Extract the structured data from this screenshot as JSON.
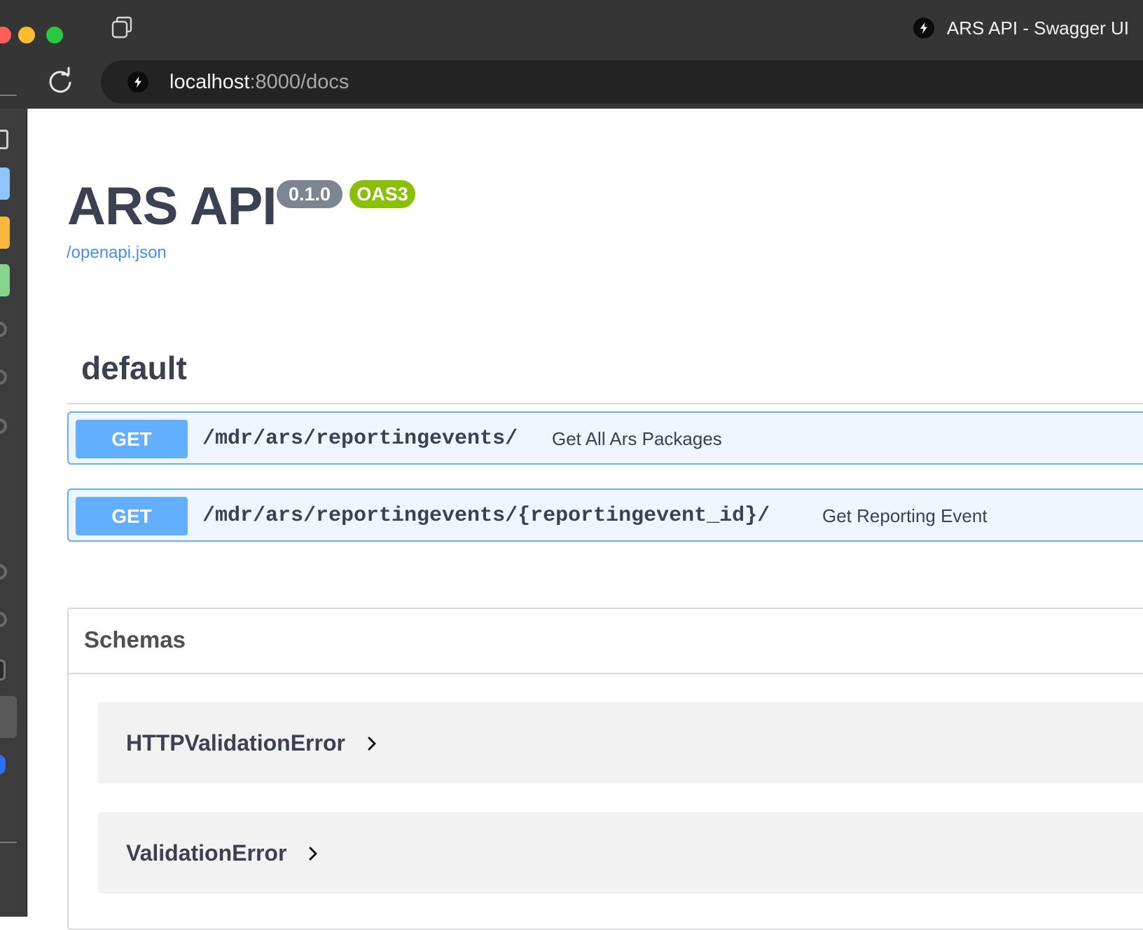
{
  "window": {
    "title": "ARS API - Swagger UI"
  },
  "address_bar": {
    "host": "localhost",
    "path": ":8000/docs"
  },
  "api": {
    "title": "ARS API",
    "version_badge": "0.1.0",
    "oas_badge": "OAS3",
    "spec_link": "/openapi.json"
  },
  "section": {
    "title": "default",
    "operations": [
      {
        "method": "GET",
        "path": "/mdr/ars/reportingevents/",
        "summary": "Get All Ars Packages"
      },
      {
        "method": "GET",
        "path": "/mdr/ars/reportingevents/{reportingevent_id}/",
        "summary": "Get Reporting Event"
      }
    ]
  },
  "schemas": {
    "title": "Schemas",
    "items": [
      {
        "name": "HTTPValidationError"
      },
      {
        "name": "ValidationError"
      }
    ]
  },
  "colors": {
    "get_method": "#61affe",
    "oas_badge": "#89bf04",
    "version_badge": "#7d8492",
    "link": "#4990e2",
    "heading": "#3b4151"
  },
  "icons": {
    "traffic_lights": [
      "close-icon",
      "minimize-icon",
      "zoom-icon"
    ],
    "tabs": "tab-overview-icon",
    "reload": "reload-icon",
    "favicon": "lightning-bolt-icon",
    "expand": "chevron-right-icon"
  }
}
